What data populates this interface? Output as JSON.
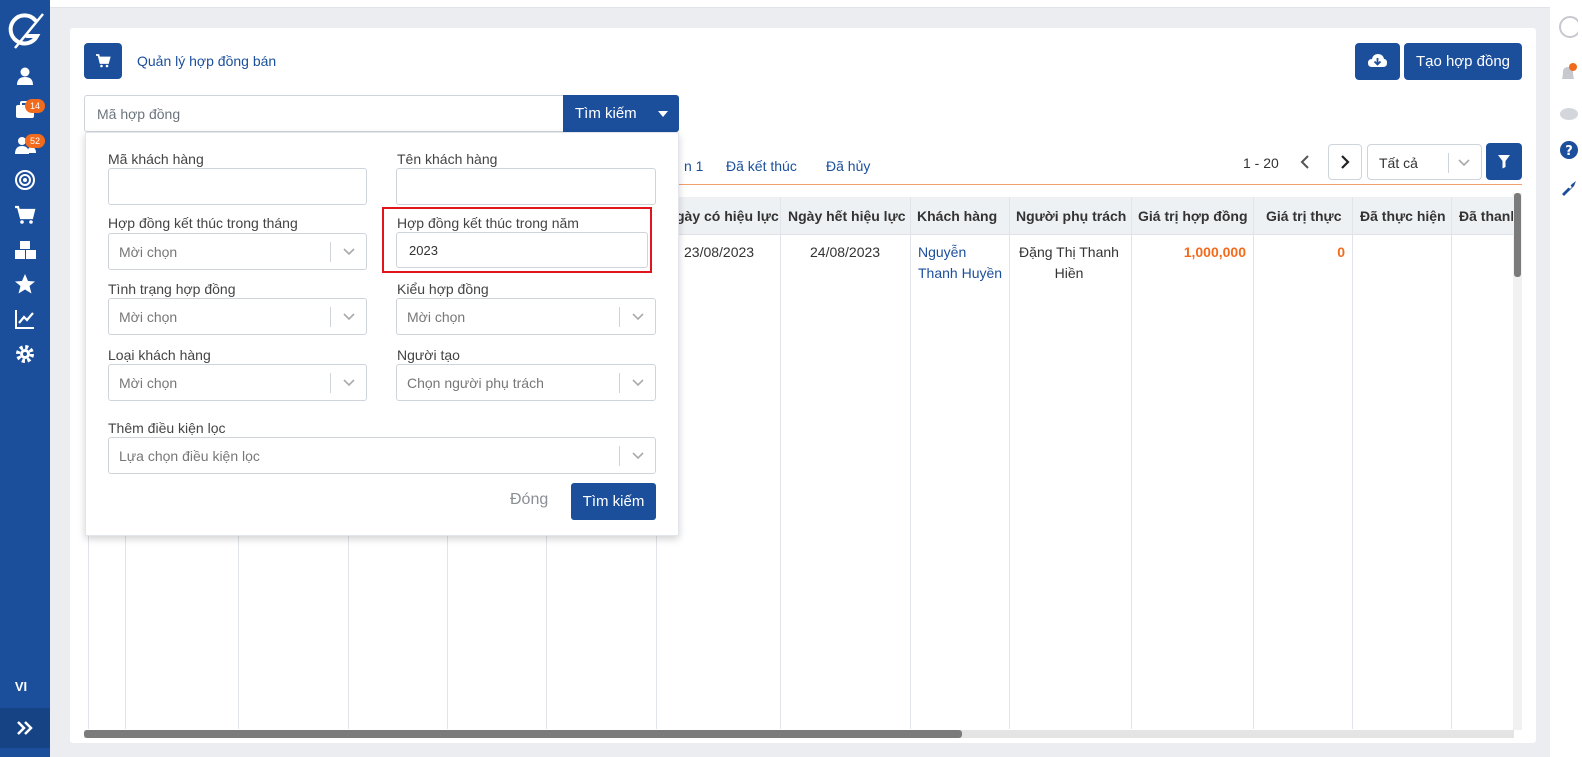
{
  "sidebar": {
    "badges": [
      "14",
      "52"
    ],
    "language": "VI",
    "icons": [
      "logo-icon",
      "user-icon",
      "briefcase-icon",
      "users-icon",
      "target-icon",
      "cart-icon",
      "cubes-icon",
      "star-icon",
      "chart-line-icon",
      "gear-icon",
      "double-chevron-right-icon"
    ]
  },
  "header": {
    "title": "Quản lý hợp đồng bán",
    "create_label": "Tạo hợp đồng"
  },
  "search": {
    "placeholder": "Mã hợp đồng",
    "button_label": "Tìm kiếm"
  },
  "tabs": [
    "n 1",
    "Đã kết thúc",
    "Đã hủy"
  ],
  "pagination": {
    "range": "1 - 20",
    "page_size": "Tất cả"
  },
  "table": {
    "headers": [
      "gày có hiệu lực",
      "Ngày hết hiệu lực",
      "Khách hàng",
      "Người phụ trách",
      "Giá trị hợp đồng",
      "Giá trị thực",
      "Đã thực hiện",
      "Đã thanh"
    ],
    "row": {
      "start_date": "23/08/2023",
      "end_date": "24/08/2023",
      "customer": "Nguyễn Thanh Huyền",
      "owner": "Đặng Thị Thanh Hiền",
      "contract_value": "1,000,000",
      "actual_value": "0"
    }
  },
  "filter": {
    "customer_code_label": "Mã khách hàng",
    "customer_name_label": "Tên khách hàng",
    "end_month_label": "Hợp đồng kết thúc trong tháng",
    "end_month_placeholder": "Mời chọn",
    "end_year_label": "Hợp đồng kết thúc trong năm",
    "end_year_value": "2023",
    "status_label": "Tình trạng hợp đồng",
    "status_placeholder": "Mời chọn",
    "type_label": "Kiểu hợp đồng",
    "type_placeholder": "Mời chọn",
    "customer_type_label": "Loại khách hàng",
    "customer_type_placeholder": "Mời chọn",
    "creator_label": "Người tạo",
    "creator_placeholder": "Chọn người phụ trách",
    "more_label": "Thêm điều kiện lọc",
    "more_placeholder": "Lựa chọn điều kiện lọc",
    "close_label": "Đóng",
    "search_label": "Tìm kiếm"
  },
  "colors": {
    "primary": "#1b4f9c",
    "accent": "#f26b1d",
    "highlight": "#e0161c"
  }
}
